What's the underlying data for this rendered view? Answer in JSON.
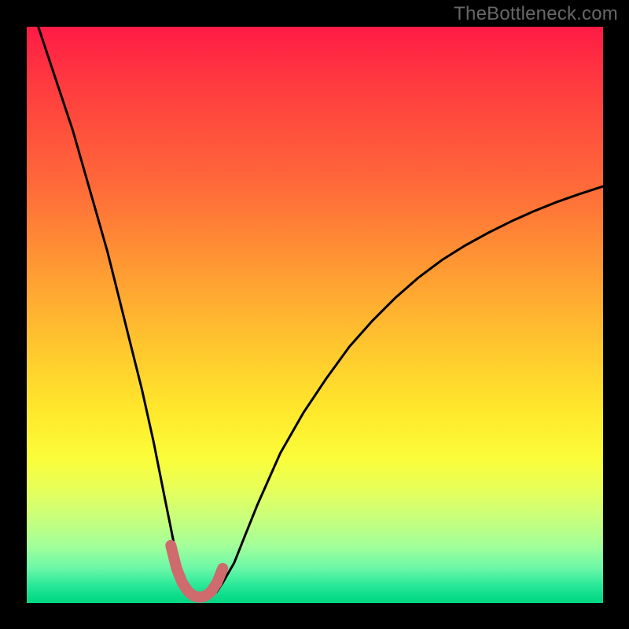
{
  "watermark": {
    "text": "TheBottleneck.com"
  },
  "colors": {
    "background": "#000000",
    "curve_stroke": "#000000",
    "highlight_stroke": "#cf6a6d",
    "gradient_top": "#ff1b46",
    "gradient_bottom": "#05d684"
  },
  "chart_data": {
    "type": "line",
    "title": "",
    "xlabel": "",
    "ylabel": "",
    "xlim": [
      0,
      100
    ],
    "ylim": [
      0,
      100
    ],
    "grid": false,
    "legend": false,
    "series": [
      {
        "name": "bottleneck-curve",
        "x": [
          2,
          4,
          6,
          8,
          10,
          12,
          14,
          16,
          18,
          20,
          22,
          23,
          24,
          25,
          26,
          27,
          28,
          29,
          30,
          31,
          32,
          33,
          34,
          36,
          38,
          40,
          44,
          48,
          52,
          56,
          60,
          64,
          68,
          72,
          76,
          80,
          84,
          88,
          92,
          96,
          100
        ],
        "y": [
          100,
          94,
          88,
          82,
          75,
          68,
          61,
          53,
          45,
          37,
          28,
          23,
          18,
          13,
          8,
          4,
          2,
          1.2,
          1,
          1,
          1.2,
          2,
          3.5,
          7,
          12,
          17,
          26,
          33,
          39,
          44.5,
          49,
          53,
          56.5,
          59.5,
          62,
          64.2,
          66.2,
          68,
          69.6,
          71,
          72.3
        ]
      },
      {
        "name": "optimal-region-highlight",
        "x": [
          25,
          26,
          27,
          28,
          29,
          30,
          31,
          32,
          33,
          34
        ],
        "y": [
          10,
          6,
          3.5,
          2,
          1.2,
          1,
          1.2,
          2,
          3.5,
          6
        ]
      }
    ],
    "annotations": []
  }
}
